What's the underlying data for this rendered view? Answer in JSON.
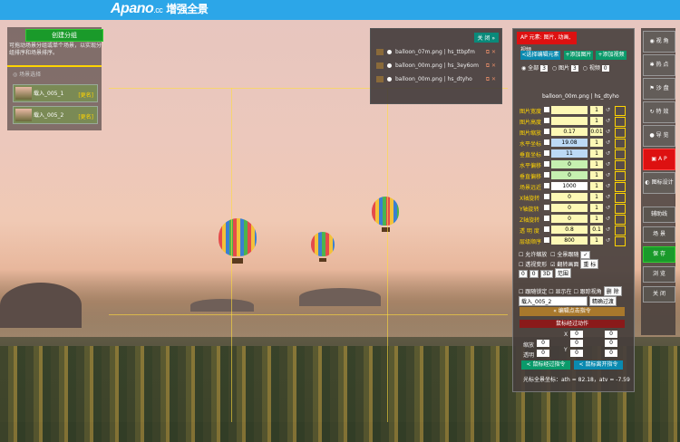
{
  "brand": {
    "logo": "Apano",
    "logo_sub": ".cc",
    "logo_cn": "增强全景"
  },
  "left_panel": {
    "create_group": "创建分组",
    "hint": "可拖动场景分组或单个场景，以实现分组排序和场景排序。",
    "group_select": "场景选择",
    "scenes": [
      {
        "name": "载入_005_1",
        "edit": "[更名]"
      },
      {
        "name": "载入_005_2",
        "edit": "[更名]"
      }
    ]
  },
  "hotspot_list": {
    "close": "关 闭 »",
    "items": [
      {
        "file": "balloon_07m.png",
        "id": "hs_ttbpfm"
      },
      {
        "file": "balloon_00m.png",
        "id": "hs_3ey6om"
      },
      {
        "file": "balloon_00m.png",
        "id": "hs_dtyho"
      }
    ]
  },
  "editor": {
    "tab": "AP 元素: 图片, 动画, 视频",
    "select_btn": "<选择编辑元素",
    "add_image": "+添加图片",
    "add_video": "+添加视频",
    "filter": {
      "all": "全部",
      "all_count": "3",
      "image": "图片",
      "image_count": "3",
      "video": "视频",
      "video_count": "0"
    },
    "current_file": "balloon_00m.png | hs_dtyho",
    "props": [
      {
        "label": "图片宽度",
        "v1": "",
        "v2": "1"
      },
      {
        "label": "图片高度",
        "v1": "",
        "v2": "1"
      },
      {
        "label": "图片缩放",
        "v1": "0.17",
        "v2": "0.01"
      },
      {
        "label": "水平坐标",
        "v1": "19.08",
        "v2": "1"
      },
      {
        "label": "垂直坐标",
        "v1": "11",
        "v2": "1"
      },
      {
        "label": "水平偏移",
        "v1": "0",
        "v2": "1"
      },
      {
        "label": "垂直偏移",
        "v1": "0",
        "v2": "1"
      },
      {
        "label": "场景远近",
        "v1": "1000",
        "v2": "1"
      },
      {
        "label": "X轴旋转",
        "v1": "0",
        "v2": "1"
      },
      {
        "label": "Y轴旋转",
        "v1": "0",
        "v2": "1"
      },
      {
        "label": "Z轴旋转",
        "v1": "0",
        "v2": "1"
      },
      {
        "label": "透 明 度",
        "v1": "0.8",
        "v2": "0.1"
      },
      {
        "label": "层级顺序",
        "v1": "800",
        "v2": "1"
      }
    ],
    "opts1": "允许缩放",
    "opts2": "全景跟随",
    "opts3": "透视变形",
    "opts4": "翻转画面",
    "opts_sel1": "重 标",
    "row_nums": [
      "0",
      "0",
      "3D",
      "范围"
    ],
    "other_label": "范围",
    "scene_lock": "跟随锁定",
    "show_cb": "显示在",
    "all_view": "跟踪视角",
    "delete": "删 除",
    "select_scene": "载入_005_2",
    "select_mode": "精确过渡",
    "edit_click": "« 编辑点击指令",
    "mouse_actions": "鼠标经过动作",
    "scale_label": "缩放",
    "opacity_label": "透明",
    "x_label": "X",
    "y_label": "Y",
    "inputs": [
      "0",
      "0",
      "0",
      "0",
      "0",
      "0",
      "0",
      "0"
    ],
    "in_cmd": "< 鼠标经过指令",
    "out_cmd": "< 鼠标离开指令",
    "coord": "光标全景坐标：ath = 82.18，atv = -7.59"
  },
  "nav": {
    "items": [
      "视 角",
      "热 点",
      "沙 盘",
      "特 效",
      "导 览",
      "A P",
      "图标设计"
    ],
    "lower": [
      "辅助线",
      "场 景",
      "保 存",
      "浏 览",
      "关 闭"
    ],
    "active": "A P"
  }
}
